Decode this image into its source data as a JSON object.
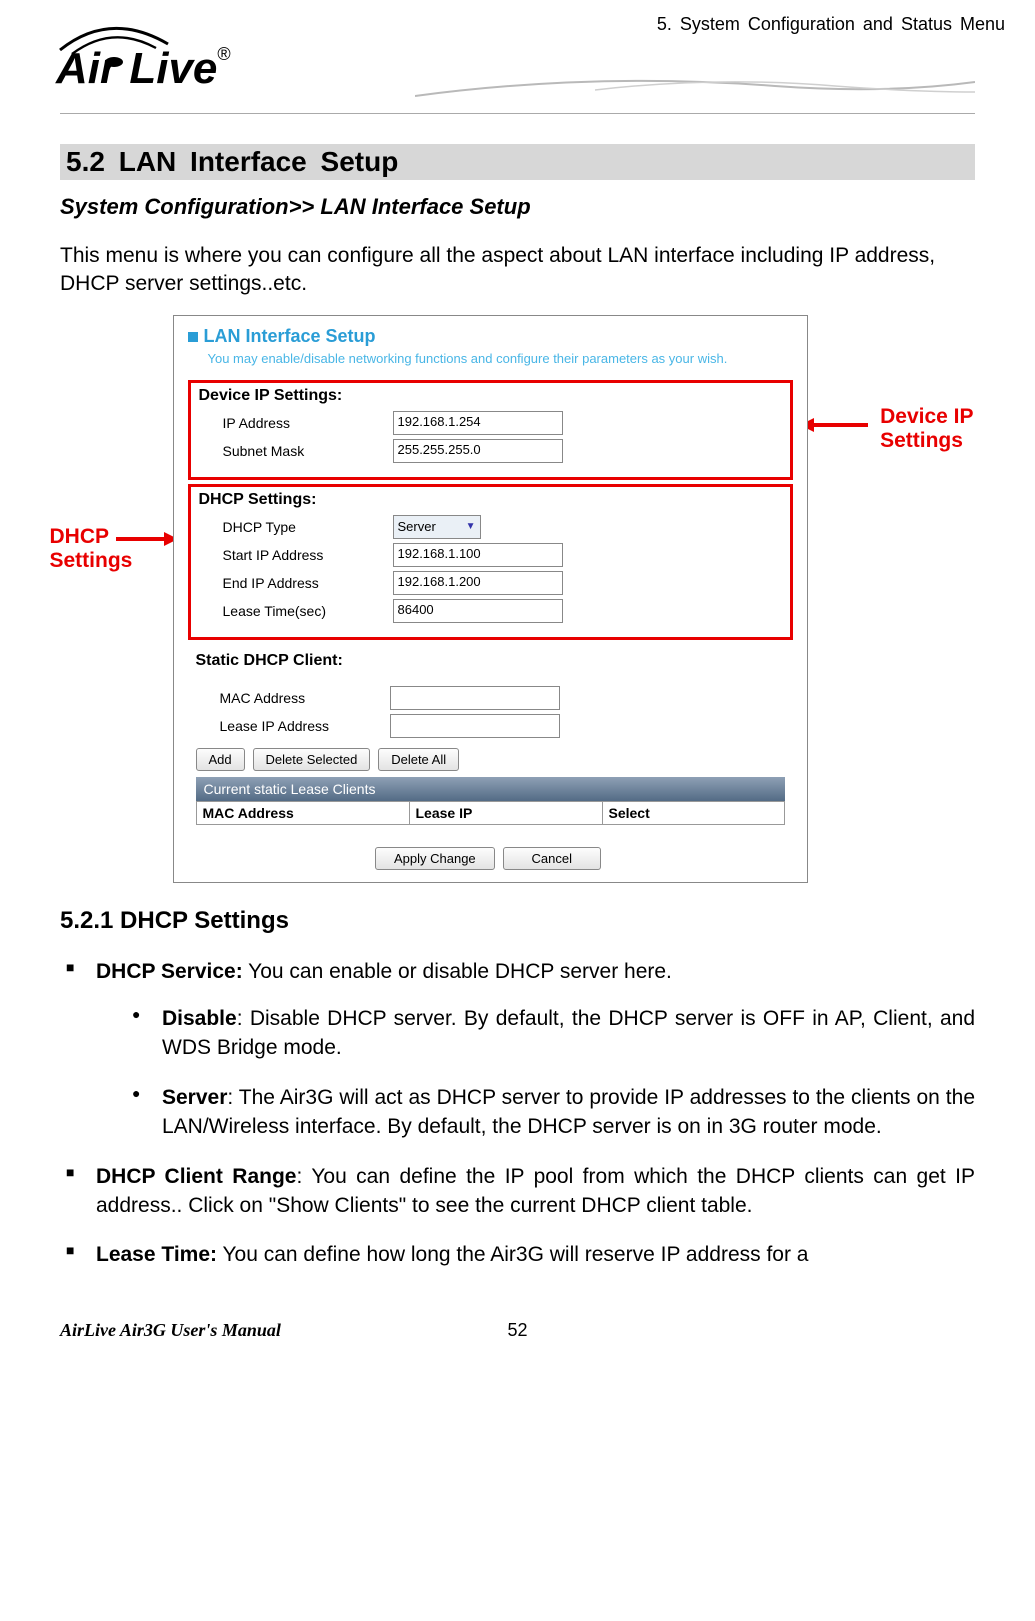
{
  "header": {
    "brand": "Air Live",
    "trademark": "®",
    "chapter_ref": "5.  System  Configuration  and  Status  Menu"
  },
  "section": {
    "number": "5.2",
    "title": " LAN  Interface  Setup",
    "breadcrumb": "System Configuration>> LAN Interface Setup",
    "intro": "This menu is where you can configure all the aspect about LAN interface including IP address, DHCP server settings..etc."
  },
  "screenshot": {
    "panel_title": "LAN Interface Setup",
    "panel_desc": "You may enable/disable networking functions and configure their parameters as your wish.",
    "device_ip": {
      "legend": "Device IP Settings:",
      "ip_label": "IP Address",
      "ip_value": "192.168.1.254",
      "mask_label": "Subnet Mask",
      "mask_value": "255.255.255.0"
    },
    "dhcp": {
      "legend": "DHCP Settings:",
      "type_label": "DHCP Type",
      "type_value": "Server",
      "start_label": "Start IP Address",
      "start_value": "192.168.1.100",
      "end_label": "End IP Address",
      "end_value": "192.168.1.200",
      "lease_label": "Lease Time(sec)",
      "lease_value": "86400"
    },
    "static": {
      "legend": "Static DHCP Client:",
      "mac_label": "MAC Address",
      "ip_label": "Lease IP Address",
      "btn_add": "Add",
      "btn_del_sel": "Delete Selected",
      "btn_del_all": "Delete All",
      "table_title": "Current static Lease Clients",
      "col1": "MAC Address",
      "col2": "Lease IP",
      "col3": "Select"
    },
    "btn_apply": "Apply Change",
    "btn_cancel": "Cancel",
    "callout_right": "Device IP Settings",
    "callout_left": "DHCP Settings"
  },
  "subsection": {
    "heading": "5.2.1    DHCP Settings",
    "items": {
      "svc_label": "DHCP Service:",
      "svc_text": "    You can enable or disable DHCP server here.",
      "disable_label": "Disable",
      "disable_text": ":    Disable DHCP server.    By default, the DHCP server is OFF in AP, Client, and WDS Bridge mode.",
      "server_label": "Server",
      "server_text": ":    The Air3G will act as DHCP server to provide IP addresses to the clients on the LAN/Wireless interface.    By default, the DHCP server is on in 3G router mode.",
      "range_label": "DHCP Client Range",
      "range_text": ": You can define the IP pool from which the DHCP clients can get IP address.. Click on \"Show Clients\" to see the current DHCP client table.",
      "lease_label": "Lease Time:",
      "lease_text": "    You can define how long the Air3G will reserve IP address for a"
    }
  },
  "footer": {
    "left": "AirLive Air3G User's Manual",
    "page": "52"
  }
}
